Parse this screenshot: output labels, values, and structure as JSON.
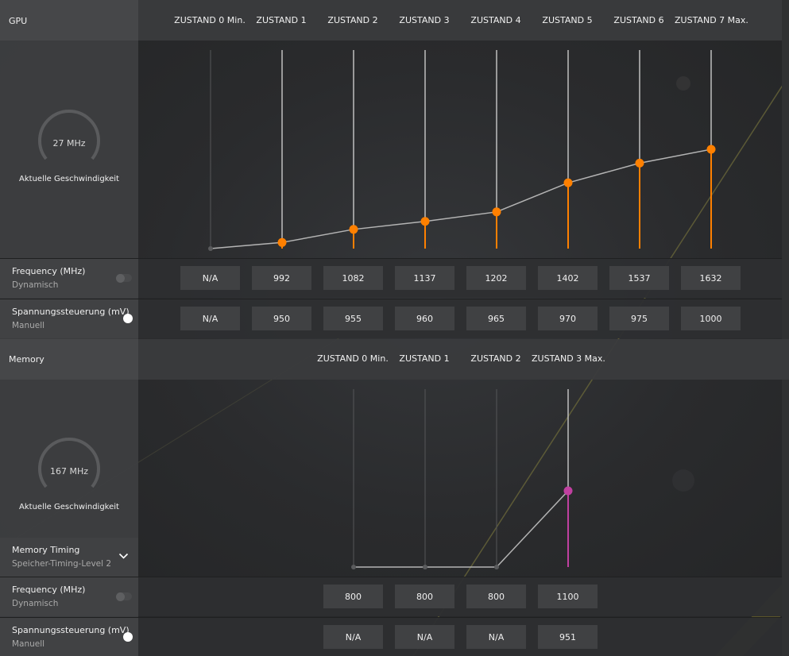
{
  "colors": {
    "gpu_accent": "#ff8000",
    "memory_accent": "#c040a0",
    "line": "#b4b4b4"
  },
  "gpu": {
    "title": "GPU",
    "states": [
      "ZUSTAND 0 Min.",
      "ZUSTAND 1",
      "ZUSTAND 2",
      "ZUSTAND 3",
      "ZUSTAND 4",
      "ZUSTAND 5",
      "ZUSTAND 6",
      "ZUSTAND 7 Max."
    ],
    "gauge": {
      "value": "27 MHz",
      "caption": "Aktuelle Geschwindigkeit"
    },
    "frequency": {
      "label": "Frequency (MHz)",
      "mode": "Dynamisch",
      "toggle_on": false,
      "values": [
        "N/A",
        "992",
        "1082",
        "1137",
        "1202",
        "1402",
        "1537",
        "1632"
      ]
    },
    "voltage": {
      "label": "Spannungssteuerung (mV)",
      "mode": "Manuell",
      "toggle_on": true,
      "values": [
        "N/A",
        "950",
        "955",
        "960",
        "965",
        "970",
        "975",
        "1000"
      ]
    }
  },
  "memory": {
    "title": "Memory",
    "states": [
      "ZUSTAND 0 Min.",
      "ZUSTAND 1",
      "ZUSTAND 2",
      "ZUSTAND 3 Max."
    ],
    "gauge": {
      "value": "167 MHz",
      "caption": "Aktuelle Geschwindigkeit"
    },
    "timing": {
      "label": "Memory Timing",
      "value": "Speicher-Timing-Level 2"
    },
    "frequency": {
      "label": "Frequency (MHz)",
      "mode": "Dynamisch",
      "toggle_on": false,
      "values": [
        "800",
        "800",
        "800",
        "1100"
      ]
    },
    "voltage": {
      "label": "Spannungssteuerung (mV)",
      "mode": "Manuell",
      "toggle_on": true,
      "values": [
        "N/A",
        "N/A",
        "N/A",
        "951"
      ]
    }
  }
}
